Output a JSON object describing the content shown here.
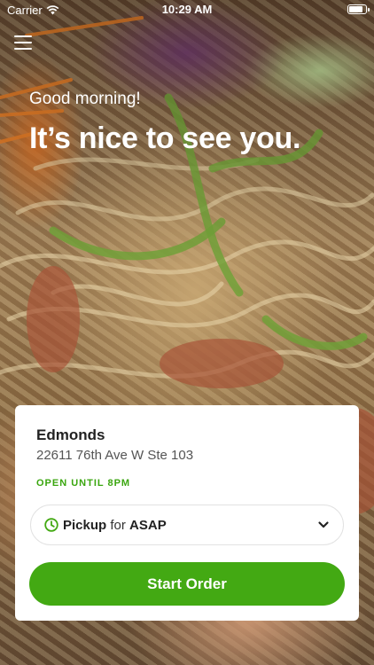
{
  "status_bar": {
    "carrier": "Carrier",
    "time": "10:29 AM",
    "battery_level": 0.9
  },
  "header": {
    "menu_icon": "hamburger-menu-icon"
  },
  "hero": {
    "greeting": "Good morning!",
    "headline": "It’s nice to see you."
  },
  "store_card": {
    "name": "Edmonds",
    "address": "22611 76th Ave W Ste 103",
    "hours": "OPEN UNTIL 8PM",
    "hours_color": "#3aa60f",
    "order_type": "Pickup",
    "connector": "for",
    "order_time": "ASAP",
    "order_icon": "clock-icon",
    "dropdown_icon": "chevron-down-icon",
    "start_button": "Start Order",
    "accent_color": "#43a913"
  }
}
